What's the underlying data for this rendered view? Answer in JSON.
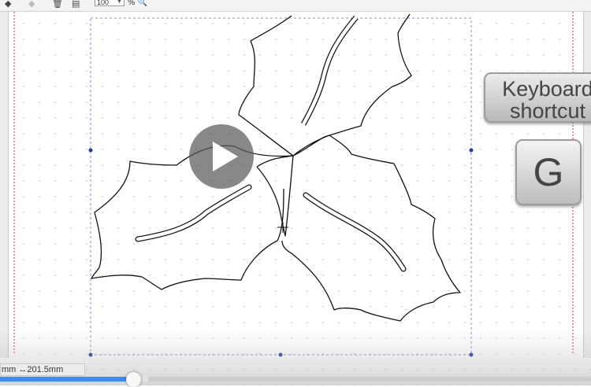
{
  "toolbar": {
    "icons": [
      "pen-tool-icon",
      "node-icon",
      "trash-icon",
      "align-icon",
      "zoom-icon"
    ],
    "zoom_value": "100",
    "zoom_unit": "%"
  },
  "overlay": {
    "shortcut_label": "Keyboard shortcut",
    "shortcut_key": "G"
  },
  "status": {
    "left_unit": "mm",
    "width_readout": "↔201.5mm"
  },
  "video": {
    "progress": 0.225,
    "buffered": 0.25,
    "play_icon": "play-icon"
  },
  "colors": {
    "accent": "#3d8af7",
    "selection_handle": "#2b3b9a",
    "guide_red": "#d03030",
    "grid_dot": "#c8c8c8"
  }
}
